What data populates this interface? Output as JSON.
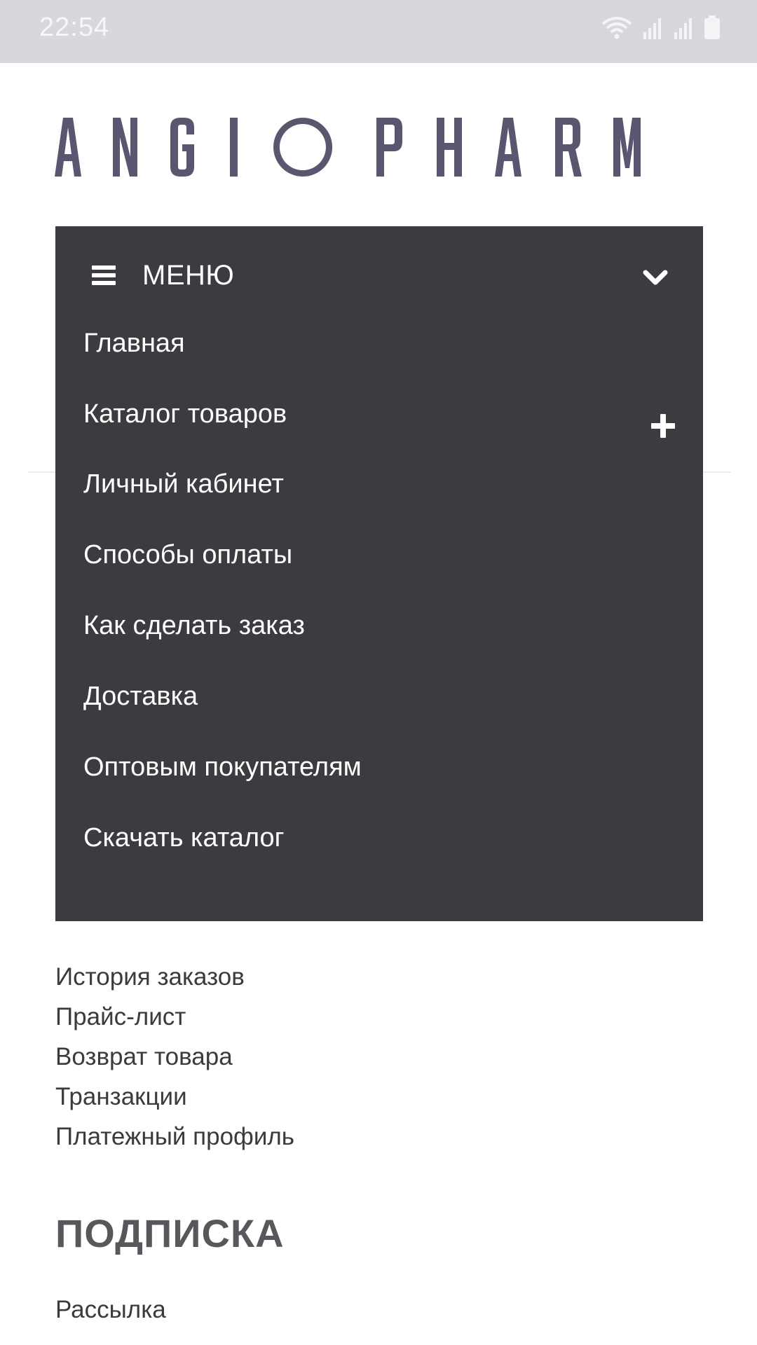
{
  "status_bar": {
    "time": "22:54",
    "icons": [
      "wifi-icon",
      "signal-icon",
      "signal-icon",
      "battery-icon"
    ]
  },
  "logo": {
    "text": "ANGIOPHARM",
    "color": "#5a5670"
  },
  "menu": {
    "title": "МЕНЮ",
    "background": "#3d3b40",
    "items": [
      {
        "label": "Главная"
      },
      {
        "label": "Каталог товаров",
        "expandable": true
      },
      {
        "label": "Личный кабинет"
      },
      {
        "label": "Способы оплаты"
      },
      {
        "label": "Как сделать заказ"
      },
      {
        "label": "Доставка"
      },
      {
        "label": "Оптовым покупателям"
      },
      {
        "label": "Скачать каталог"
      }
    ]
  },
  "account": {
    "links": [
      "История заказов",
      "Прайс-лист",
      "Возврат товара",
      "Транзакции",
      "Платежный профиль"
    ]
  },
  "subscription": {
    "heading": "ПОДПИСКА",
    "link": "Рассылка"
  }
}
